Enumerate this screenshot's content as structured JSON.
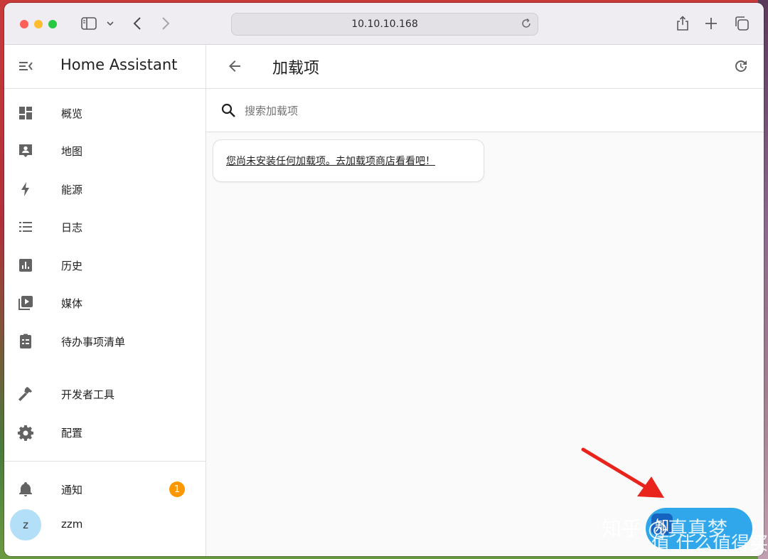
{
  "browser": {
    "url": "10.10.10.168"
  },
  "sidebar": {
    "title": "Home Assistant",
    "items": [
      {
        "label": "概览",
        "icon": "dashboard-icon"
      },
      {
        "label": "地图",
        "icon": "map-account-icon"
      },
      {
        "label": "能源",
        "icon": "lightning-bolt-icon"
      },
      {
        "label": "日志",
        "icon": "format-list-icon"
      },
      {
        "label": "历史",
        "icon": "chart-box-icon"
      },
      {
        "label": "媒体",
        "icon": "play-box-multiple-icon"
      },
      {
        "label": "待办事项清单",
        "icon": "clipboard-list-icon"
      }
    ],
    "tools": [
      {
        "label": "开发者工具",
        "icon": "hammer-icon"
      },
      {
        "label": "配置",
        "icon": "cog-icon"
      }
    ],
    "notifications": {
      "label": "通知",
      "count": "1"
    },
    "user": {
      "initial": "z",
      "name": "zzm"
    }
  },
  "main": {
    "title": "加载项",
    "search_placeholder": "搜索加载项",
    "empty_message": "您尚未安装任何加载项。去加载项商店看看吧！"
  },
  "watermark": {
    "line1": "知乎 @真真梦",
    "line2": "值 什么值得买"
  },
  "colors": {
    "badge": "#ff9800",
    "avatar": "#b3e0f8",
    "icon": "#636363"
  }
}
